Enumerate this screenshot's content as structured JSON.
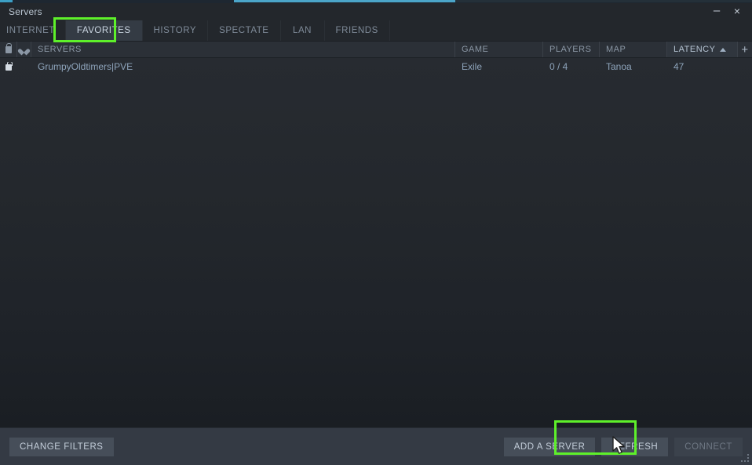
{
  "window": {
    "title": "Servers",
    "minimize_label": "–",
    "close_label": "×"
  },
  "tabs": [
    {
      "label": "INTERNET",
      "active": false
    },
    {
      "label": "FAVORITES",
      "active": true
    },
    {
      "label": "HISTORY",
      "active": false
    },
    {
      "label": "SPECTATE",
      "active": false
    },
    {
      "label": "LAN",
      "active": false
    },
    {
      "label": "FRIENDS",
      "active": false
    }
  ],
  "table": {
    "columns": {
      "lock": "",
      "favorite": "",
      "servers": "SERVERS",
      "game": "GAME",
      "players": "PLAYERS",
      "map": "MAP",
      "latency": "LATENCY",
      "add": "+"
    },
    "sort": {
      "column": "LATENCY",
      "direction": "ascending",
      "arrow": "▲"
    },
    "rows": [
      {
        "locked": true,
        "name": "GrumpyOldtimers|PVE",
        "game": "Exile",
        "players": "0 / 4",
        "map": "Tanoa",
        "latency": "47"
      }
    ]
  },
  "footer": {
    "change_filters": "CHANGE FILTERS",
    "add_a_server": "ADD A SERVER",
    "refresh": "REFRESH",
    "connect": "CONNECT",
    "connect_disabled": true
  },
  "highlights": {
    "color": "#5EF02A",
    "targets": [
      "FAVORITES",
      "ADD A SERVER"
    ]
  },
  "colors": {
    "window_bg": "#23272C",
    "tab_active_bg": "#343B44",
    "header_bg": "#2B3037",
    "footer_bg": "#343A44",
    "button_bg": "#464E59",
    "text_primary": "#C3CDD9",
    "text_muted": "#7F8B99",
    "row_text": "#8EA4BB",
    "accent_green": "#5EF02A",
    "accent_blue": "#4BA5C9"
  }
}
